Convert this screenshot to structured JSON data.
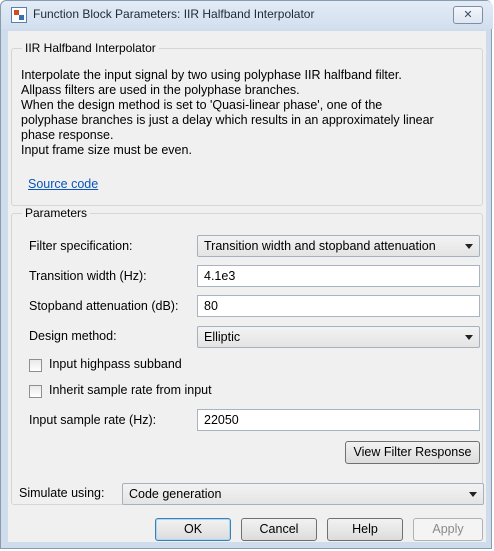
{
  "window": {
    "title": "Function Block Parameters: IIR Halfband Interpolator",
    "close_symbol": "✕"
  },
  "block": {
    "group_title": "IIR Halfband Interpolator",
    "description_lines": [
      "Interpolate the input signal by two using polyphase IIR halfband filter.",
      "Allpass filters are used in the polyphase branches.",
      "When the design method is set to 'Quasi-linear phase', one of the",
      "polyphase branches is just a delay which results in an approximately linear",
      "phase response.",
      "Input frame size must be even."
    ],
    "source_link": "Source code"
  },
  "parameters": {
    "group_title": "Parameters",
    "filter_spec_label": "Filter specification:",
    "filter_spec_value": "Transition width and stopband attenuation",
    "transition_width_label": "Transition width (Hz):",
    "transition_width_value": "4.1e3",
    "stopband_label": "Stopband attenuation (dB):",
    "stopband_value": "80",
    "design_method_label": "Design method:",
    "design_method_value": "Elliptic",
    "highpass_label": "Input highpass subband",
    "highpass_checked": false,
    "inherit_label": "Inherit sample rate from input",
    "inherit_checked": false,
    "sample_rate_label": "Input sample rate (Hz):",
    "sample_rate_value": "22050",
    "view_response_label": "View Filter Response"
  },
  "simulate": {
    "label": "Simulate using:",
    "value": "Code generation"
  },
  "buttons": {
    "ok": "OK",
    "cancel": "Cancel",
    "help": "Help",
    "apply": "Apply"
  }
}
